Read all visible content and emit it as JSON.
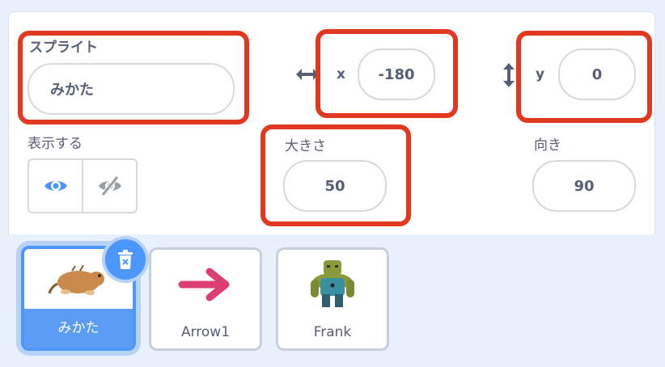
{
  "sprite_info": {
    "sprite_label": "スプライト",
    "sprite_name": "みかた",
    "x_label": "x",
    "x_value": "-180",
    "y_label": "y",
    "y_value": "0",
    "show_label": "表示する",
    "size_label": "大きさ",
    "size_value": "50",
    "direction_label": "向き",
    "direction_value": "90"
  },
  "sprites": [
    {
      "name": "みかた",
      "selected": true
    },
    {
      "name": "Arrow1",
      "selected": false
    },
    {
      "name": "Frank",
      "selected": false
    }
  ],
  "colors": {
    "highlight": "#e2381f",
    "accent": "#4c97ff",
    "arrow_pink": "#dd3f73"
  },
  "icons": [
    "horizontal-arrow-icon",
    "vertical-arrow-icon",
    "eye-icon",
    "eye-slash-icon",
    "trash-icon"
  ]
}
